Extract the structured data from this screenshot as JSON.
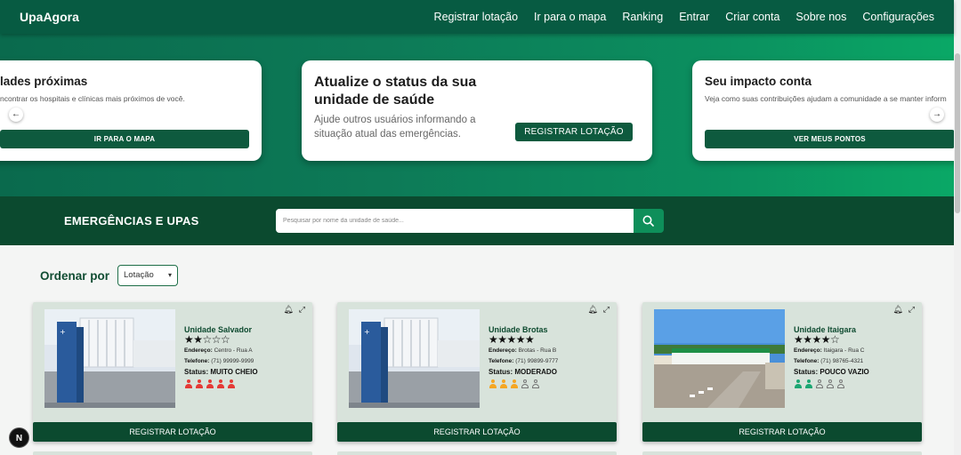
{
  "navbar": {
    "brand": "UpaAgora",
    "links": [
      "Registrar lotação",
      "Ir para o mapa",
      "Ranking",
      "Entrar",
      "Criar conta",
      "Sobre nos",
      "Configurações"
    ]
  },
  "carousel": {
    "left": {
      "title": "lades próximas",
      "text": "ncontrar os hospitais e clínicas mais próximos de você.",
      "button": "IR PARA O MAPA",
      "arrow": "←"
    },
    "center": {
      "title": "Atualize o status da sua unidade de saúde",
      "text": "Ajude outros usuários informando a situação atual das emergências.",
      "button": "REGISTRAR LOTAÇÃO"
    },
    "right": {
      "title": "Seu impacto conta",
      "text": "Veja como suas contribuições ajudam a comunidade a se manter inform",
      "button": "VER MEUS PONTOS",
      "arrow": "→"
    }
  },
  "search": {
    "title": "EMERGÊNCIAS E UPAS",
    "placeholder": "Pesquisar por nome da unidade de saúde..."
  },
  "sort": {
    "label": "Ordenar por",
    "selected": "Lotação"
  },
  "cards": [
    {
      "name": "Unidade Salvador",
      "stars": "★★☆☆☆",
      "rating": 2,
      "address_label": "Endereço:",
      "address": "Centro - Rua A",
      "phone_label": "Telefone:",
      "phone": "(71) 99999-9999",
      "status_label": "Status:",
      "status": "MUITO CHEIO",
      "occupancy": 5,
      "occupancy_max": 5,
      "occupancy_color": "#e53935",
      "button": "REGISTRAR LOTAÇÃO"
    },
    {
      "name": "Unidade Brotas",
      "stars": "★★★★★",
      "rating": 5,
      "address_label": "Endereço:",
      "address": "Brotas - Rua B",
      "phone_label": "Telefone:",
      "phone": "(71) 99899-9777",
      "status_label": "Status:",
      "status": "MODERADO",
      "occupancy": 3,
      "occupancy_max": 5,
      "occupancy_color": "#f5a623",
      "button": "REGISTRAR LOTAÇÃO"
    },
    {
      "name": "Unidade Itaigara",
      "stars": "★★★★☆",
      "rating": 4,
      "address_label": "Endereço:",
      "address": "Itaigara - Rua C",
      "phone_label": "Telefone:",
      "phone": "(71) 98765-4321",
      "status_label": "Status:",
      "status": "POUCO VAZIO",
      "occupancy": 2,
      "occupancy_max": 5,
      "occupancy_color": "#1ba672",
      "button": "REGISTRAR LOTAÇÃO"
    }
  ],
  "fab": "N"
}
